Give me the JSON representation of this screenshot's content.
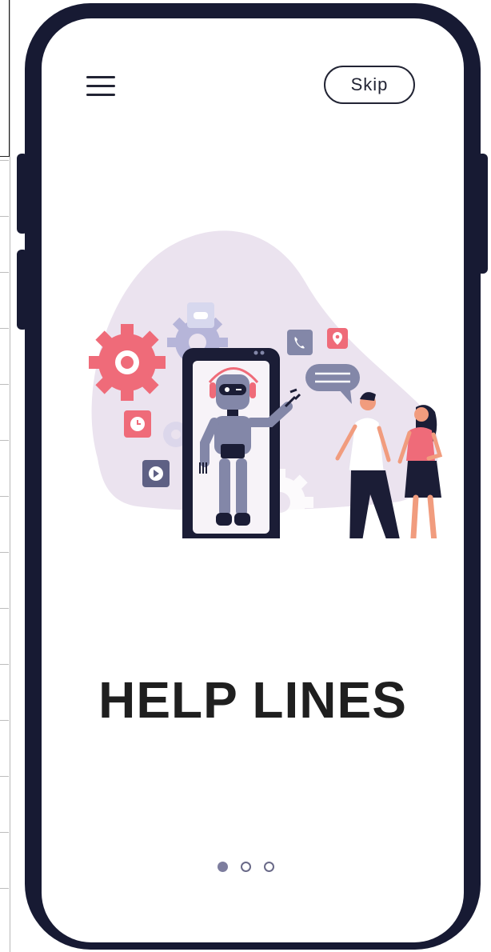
{
  "header": {
    "menu_icon": "hamburger-menu-icon",
    "skip_label": "Skip"
  },
  "onboarding": {
    "title": "HELP LINES",
    "current_page": 1,
    "total_pages": 3
  },
  "colors": {
    "phone_frame": "#171a33",
    "title_text": "#1f1f1f",
    "blob": "#ebe3ef",
    "accent_pink": "#ef6b79",
    "robot_gray": "#8387a8",
    "dot_active": "#7d7d9e"
  }
}
